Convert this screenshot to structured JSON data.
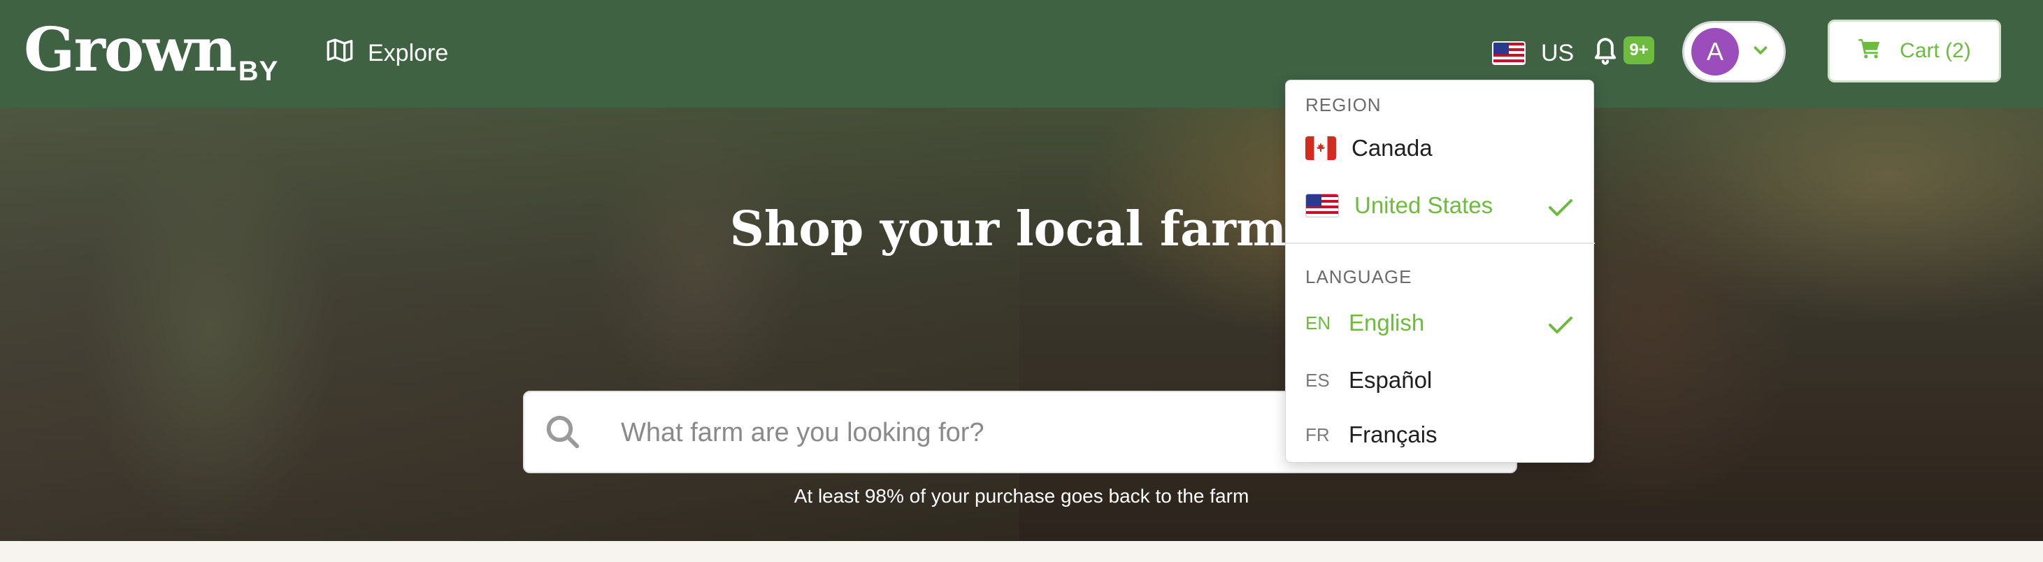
{
  "header": {
    "logo_main": "Grown",
    "logo_by": "BY",
    "explore_label": "Explore",
    "region_code": "US",
    "notifications_badge": "9+",
    "avatar_initial": "A",
    "cart_label": "Cart (2)"
  },
  "hero": {
    "title": "Shop your local farms",
    "search_placeholder": "What farm are you looking for?",
    "tagline": "At least 98% of your purchase goes back to the farm"
  },
  "dropdown": {
    "region_title": "REGION",
    "regions": [
      {
        "label": "Canada",
        "flag": "canada-flag-icon",
        "selected": false
      },
      {
        "label": "United States",
        "flag": "us-flag-icon",
        "selected": true
      }
    ],
    "language_title": "LANGUAGE",
    "languages": [
      {
        "code": "EN",
        "label": "English",
        "selected": true
      },
      {
        "code": "ES",
        "label": "Español",
        "selected": false
      },
      {
        "code": "FR",
        "label": "Français",
        "selected": false
      }
    ]
  },
  "colors": {
    "header_bg": "#3f6243",
    "accent_green": "#6dbb3f",
    "avatar_purple": "#9b4dbb",
    "page_bg": "#f7f3ee"
  }
}
